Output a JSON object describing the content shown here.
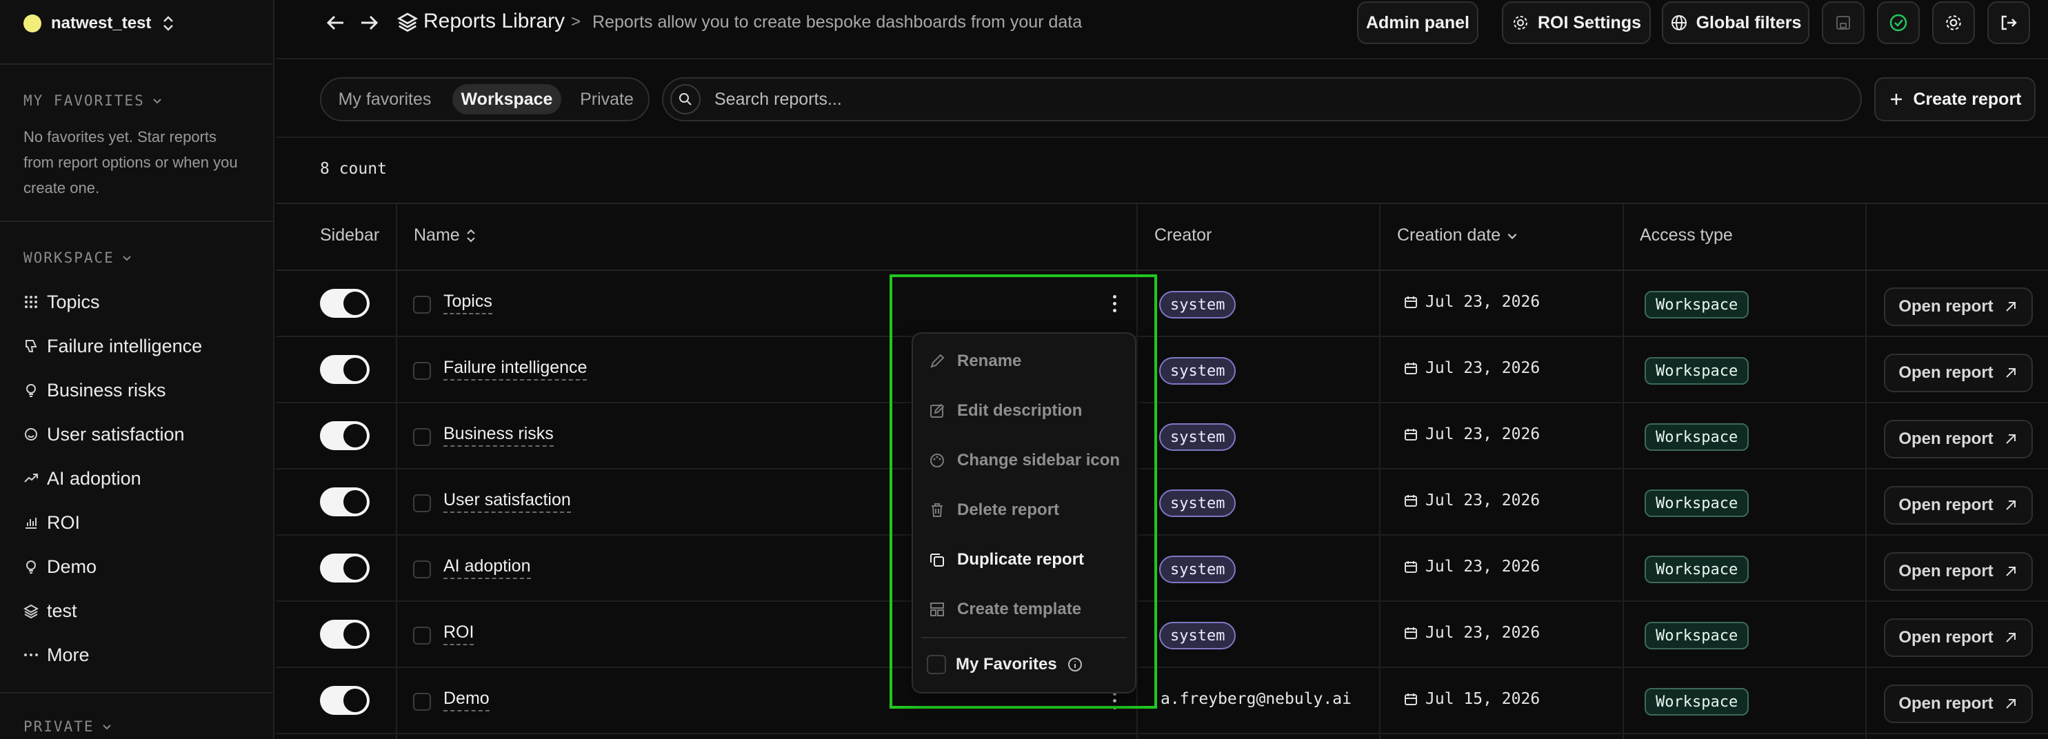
{
  "sidebar": {
    "workspace_name": "natwest_test",
    "favorites_label": "MY FAVORITES",
    "favorites_empty": "No favorites yet. Star reports from report options or when you create one.",
    "workspace_label": "WORKSPACE",
    "items": [
      {
        "label": "Topics",
        "icon": "grid-dots-icon"
      },
      {
        "label": "Failure intelligence",
        "icon": "thumbs-down-icon"
      },
      {
        "label": "Business risks",
        "icon": "lightbulb-icon"
      },
      {
        "label": "User satisfaction",
        "icon": "smile-icon"
      },
      {
        "label": "AI adoption",
        "icon": "trend-up-icon"
      },
      {
        "label": "ROI",
        "icon": "bar-chart-icon"
      },
      {
        "label": "Demo",
        "icon": "lightbulb-icon"
      },
      {
        "label": "test",
        "icon": "layers-icon"
      },
      {
        "label": "More",
        "icon": "more-dots-icon"
      }
    ],
    "private_label": "PRIVATE"
  },
  "header": {
    "title": "Reports Library",
    "separator": ">",
    "description": "Reports allow you to create bespoke dashboards from your data",
    "admin_panel": "Admin panel",
    "roi_settings": "ROI Settings",
    "global_filters": "Global filters"
  },
  "toolbar": {
    "tabs": [
      "My favorites",
      "Workspace",
      "Private"
    ],
    "active_tab": "Workspace",
    "search_placeholder": "Search reports...",
    "create_report": "Create report",
    "count": "8 count"
  },
  "table": {
    "headers": {
      "sidebar": "Sidebar",
      "name": "Name",
      "creator": "Creator",
      "creation_date": "Creation date",
      "access_type": "Access type"
    },
    "open_label": "Open report",
    "rows": [
      {
        "name": "Topics",
        "creator": "system",
        "date": "Jul 23, 2026",
        "access": "Workspace",
        "sidebar_on": true
      },
      {
        "name": "Failure intelligence",
        "creator": "system",
        "date": "Jul 23, 2026",
        "access": "Workspace",
        "sidebar_on": true
      },
      {
        "name": "Business risks",
        "creator": "system",
        "date": "Jul 23, 2026",
        "access": "Workspace",
        "sidebar_on": true
      },
      {
        "name": "User satisfaction",
        "creator": "system",
        "date": "Jul 23, 2026",
        "access": "Workspace",
        "sidebar_on": true
      },
      {
        "name": "AI adoption",
        "creator": "system",
        "date": "Jul 23, 2026",
        "access": "Workspace",
        "sidebar_on": true
      },
      {
        "name": "ROI",
        "creator": "system",
        "date": "Jul 23, 2026",
        "access": "Workspace",
        "sidebar_on": true
      },
      {
        "name": "Demo",
        "creator": "a.freyberg@nebuly.ai",
        "date": "Jul 15, 2026",
        "access": "Workspace",
        "sidebar_on": true
      }
    ]
  },
  "context_menu": {
    "items": [
      {
        "label": "Rename",
        "icon": "pencil-icon",
        "enabled": false
      },
      {
        "label": "Edit description",
        "icon": "edit-square-icon",
        "enabled": false
      },
      {
        "label": "Change sidebar icon",
        "icon": "palette-icon",
        "enabled": false
      },
      {
        "label": "Delete report",
        "icon": "trash-icon",
        "enabled": false
      },
      {
        "label": "Duplicate report",
        "icon": "copy-icon",
        "enabled": true
      },
      {
        "label": "Create template",
        "icon": "template-icon",
        "enabled": false
      }
    ],
    "favorites_label": "My Favorites"
  },
  "colors": {
    "accent_green": "#20c71e",
    "system_pill": "#7e78c6",
    "workspace_pill": "#3c6a58"
  }
}
